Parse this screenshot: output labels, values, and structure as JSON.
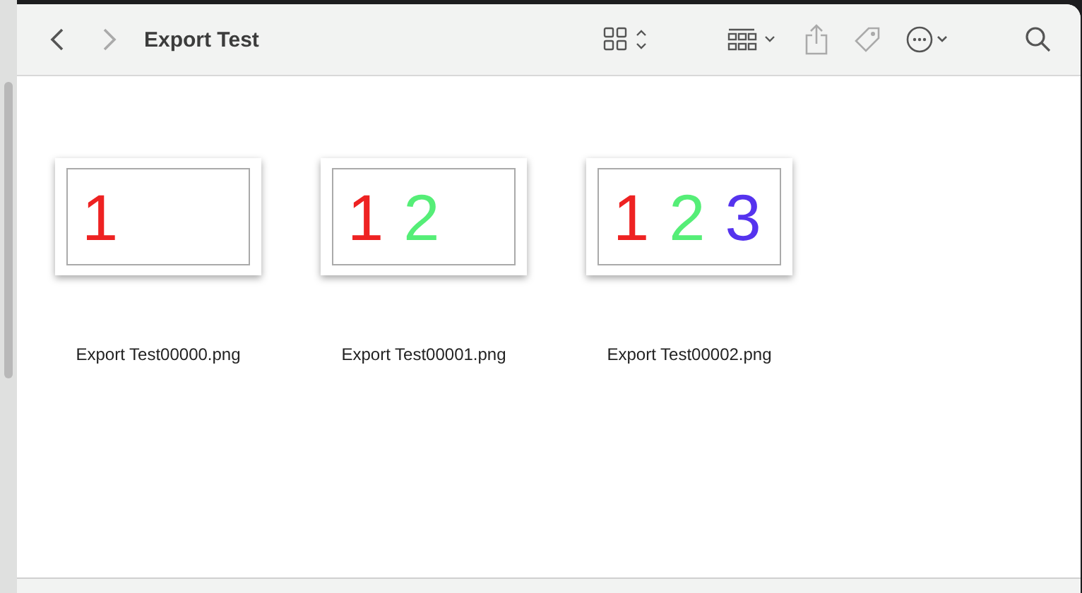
{
  "window": {
    "title": "Export Test"
  },
  "files": [
    {
      "name": "Export Test00000.png",
      "selected": false,
      "thumbnail": [
        {
          "text": "1",
          "color": "#ee2222"
        }
      ]
    },
    {
      "name": "Export Test00001.png",
      "selected": false,
      "thumbnail": [
        {
          "text": "1",
          "color": "#ee2222"
        },
        {
          "text": "2",
          "color": "#55ee77"
        }
      ]
    },
    {
      "name": "Export Test00002.png",
      "selected": false,
      "thumbnail": [
        {
          "text": "1",
          "color": "#ee2222"
        },
        {
          "text": "2",
          "color": "#55ee77"
        },
        {
          "text": "3",
          "color": "#5533ee"
        }
      ]
    }
  ]
}
